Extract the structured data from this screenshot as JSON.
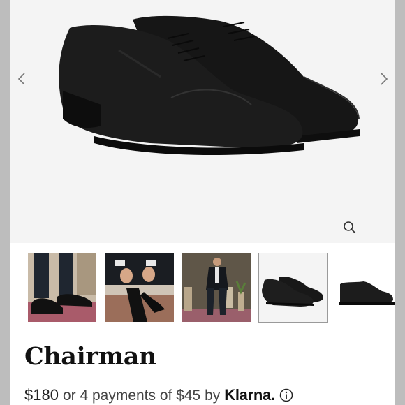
{
  "product": {
    "name": "Chairman",
    "price": "$180",
    "installment_text": "or 4 payments of $45 by",
    "provider": "Klarna."
  },
  "gallery": {
    "selected_index": 3,
    "thumbnail_count": 5
  },
  "colors": {
    "background": "#f4f4f4",
    "shoe": "#1a1a1a",
    "text": "#111111"
  },
  "icons": {
    "prev": "chevron-left-icon",
    "next": "chevron-right-icon",
    "zoom": "magnifier-icon",
    "info": "info-circle-icon"
  }
}
